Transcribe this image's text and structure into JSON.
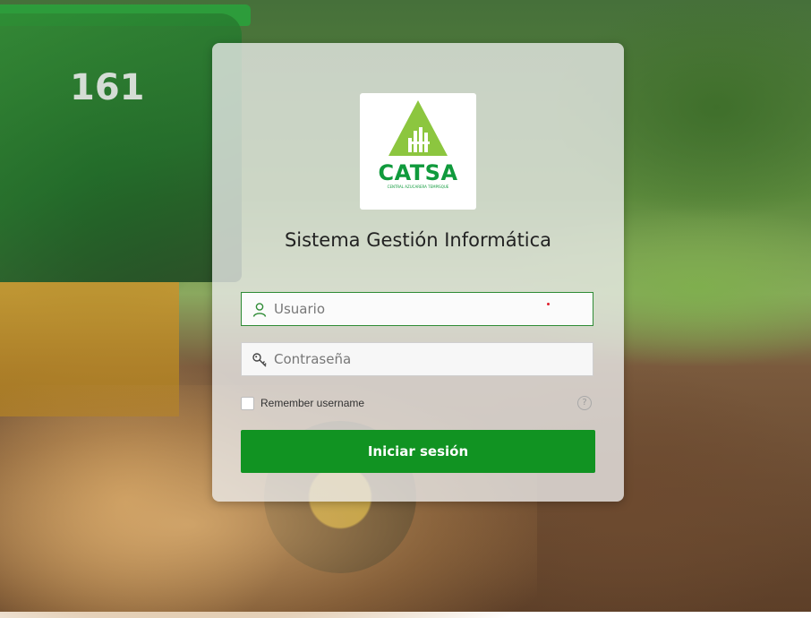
{
  "logo": {
    "name": "CATSA",
    "tagline": "CENTRAL AZUCARERA TEMPISQUE",
    "brand_color": "#109a3c"
  },
  "page_title": "Sistema Gestión Informática",
  "username": {
    "placeholder": "Usuario",
    "value": "",
    "icon": "user-icon"
  },
  "password": {
    "placeholder": "Contraseña",
    "value": "",
    "icon": "key-icon"
  },
  "remember": {
    "label": "Remember username",
    "checked": false
  },
  "help_icon": "?",
  "login_button": {
    "label": "Iniciar sesión",
    "color": "#119322"
  },
  "background_text": "161"
}
